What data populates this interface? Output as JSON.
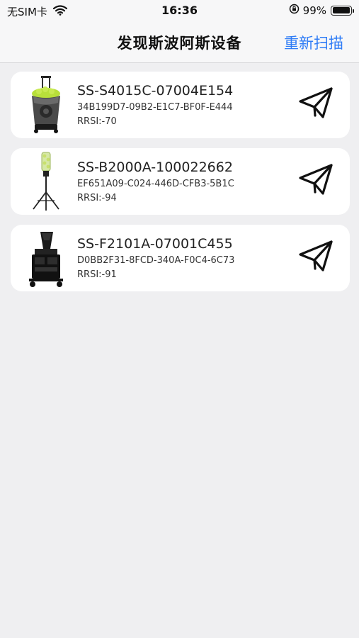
{
  "status_bar": {
    "carrier": "无SIM卡",
    "time": "16:36",
    "battery": "99%",
    "battery_level": 0.99
  },
  "nav": {
    "title": "发现斯波阿斯设备",
    "rescan_label": "重新扫描",
    "accent_color": "#2f7cf6"
  },
  "devices": [
    {
      "name": "SS-S4015C-07004E154",
      "uuid": "34B199D7-09B2-E1C7-BF0F-E444",
      "rssi": "RRSI:-70",
      "image_icon": "ball-machine-s4015c-icon",
      "action_icon": "send-paper-plane-icon"
    },
    {
      "name": "SS-B2000A-100022662",
      "uuid": "EF651A09-C024-446D-CFB3-5B1C",
      "rssi": "RRSI:-94",
      "image_icon": "ball-machine-tripod-icon",
      "action_icon": "send-paper-plane-icon"
    },
    {
      "name": "SS-F2101A-07001C455",
      "uuid": "D0BB2F31-8FCD-340A-F0C4-6C73",
      "rssi": "RRSI:-91",
      "image_icon": "ball-machine-f2101a-icon",
      "action_icon": "send-paper-plane-icon"
    }
  ]
}
